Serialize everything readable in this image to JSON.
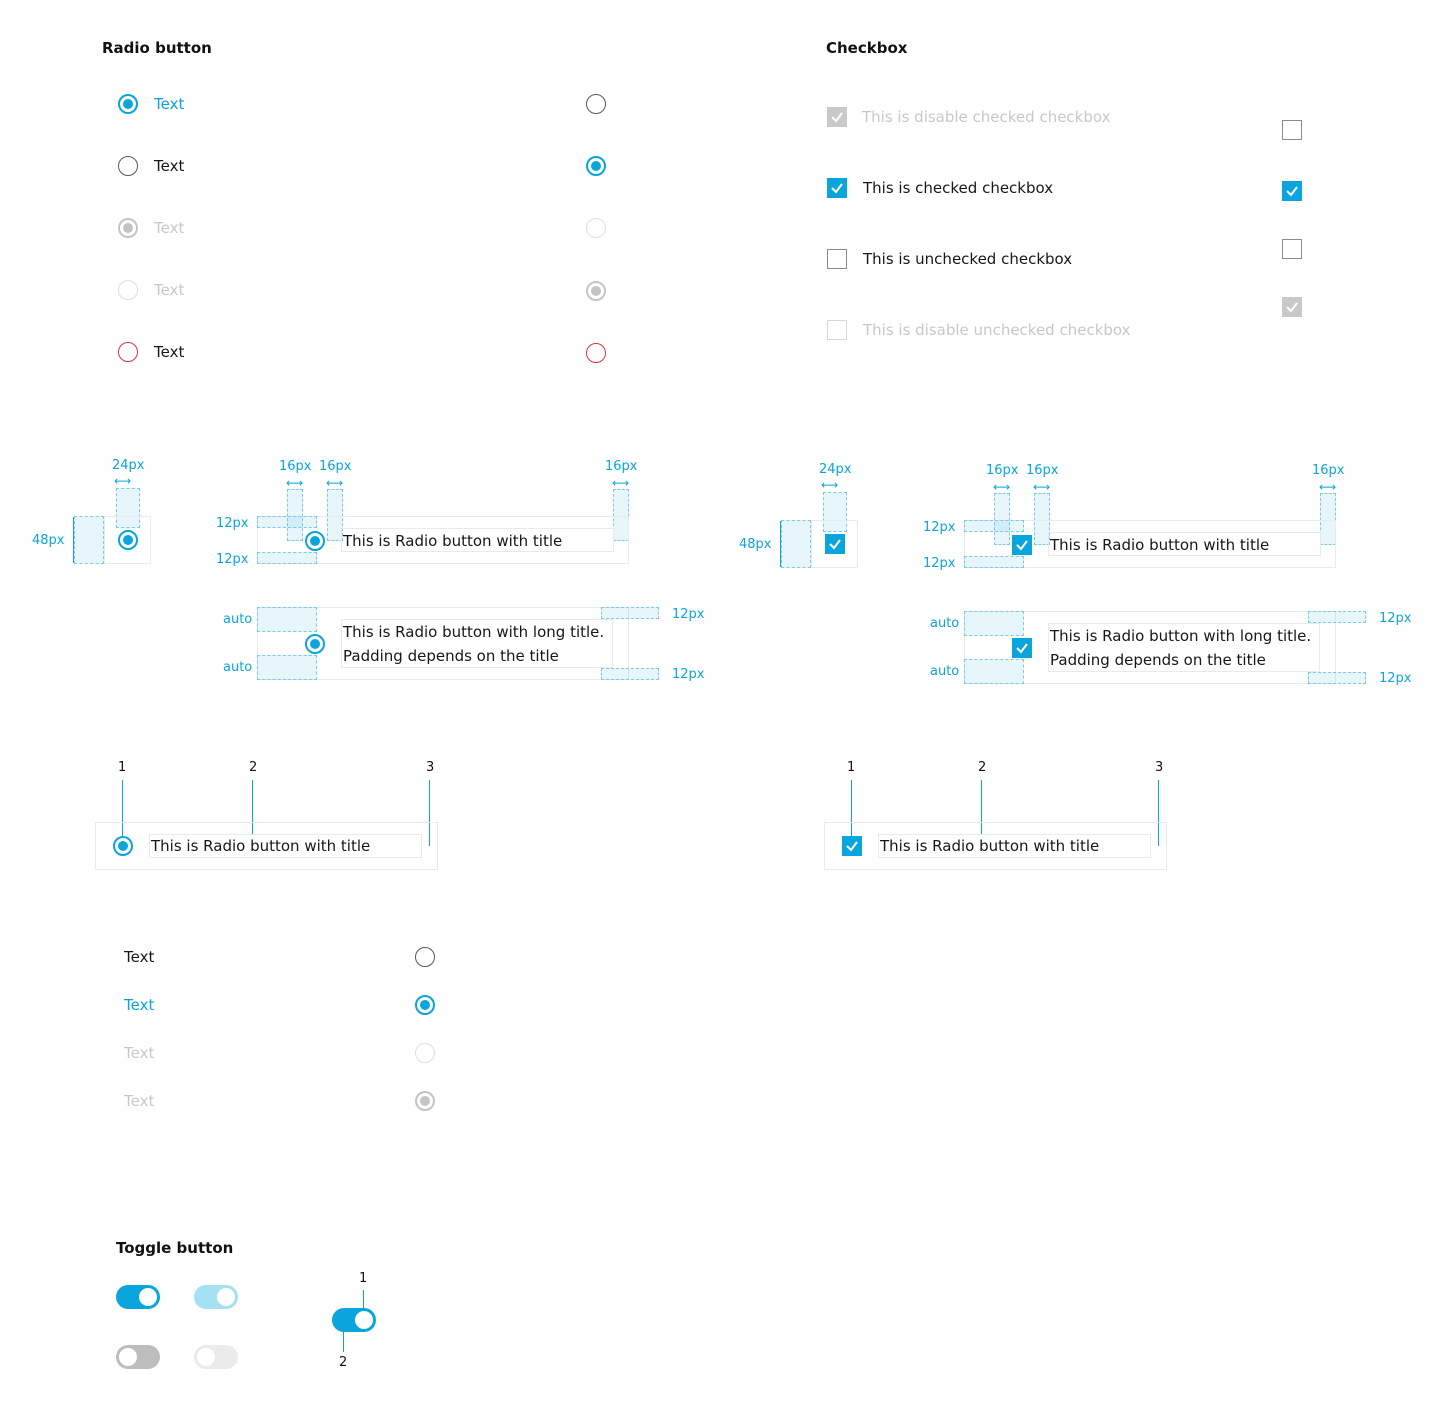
{
  "sections": {
    "radio_title": "Radio button",
    "checkbox_title": "Checkbox",
    "toggle_title": "Toggle button"
  },
  "radio_list": [
    {
      "label": "Text",
      "state": "checked"
    },
    {
      "label": "Text",
      "state": "unchecked"
    },
    {
      "label": "Text",
      "state": "disabled-checked"
    },
    {
      "label": "Text",
      "state": "disabled-unchecked"
    },
    {
      "label": "Text",
      "state": "error"
    }
  ],
  "checkbox_list": [
    {
      "label": "This is disable checked checkbox",
      "state": "disabled-checked"
    },
    {
      "label": "This is checked checkbox",
      "state": "checked"
    },
    {
      "label": "This is unchecked checkbox",
      "state": "unchecked"
    },
    {
      "label": "This is disable unchecked checkbox",
      "state": "disabled-unchecked"
    }
  ],
  "spec": {
    "size_24": "24px",
    "size_48": "48px",
    "size_16": "16px",
    "size_12": "12px",
    "auto": "auto",
    "title_single": "This is Radio button with title",
    "title_long_1": "This is Radio button with long title.",
    "title_long_2": "Padding depends on the title"
  },
  "anatomy": {
    "n1": "1",
    "n2": "2",
    "n3": "3",
    "title": "This is Radio button with title"
  },
  "trailing_list": [
    {
      "label": "Text",
      "state": "unchecked"
    },
    {
      "label": "Text",
      "state": "checked"
    },
    {
      "label": "Text",
      "state": "disabled-unchecked"
    },
    {
      "label": "Text",
      "state": "disabled-checked"
    }
  ],
  "toggle_anatomy": {
    "n1": "1",
    "n2": "2"
  },
  "colors": {
    "accent": "#0aa5dc",
    "error": "#e0333f",
    "disabled": "#c4c4c4"
  }
}
